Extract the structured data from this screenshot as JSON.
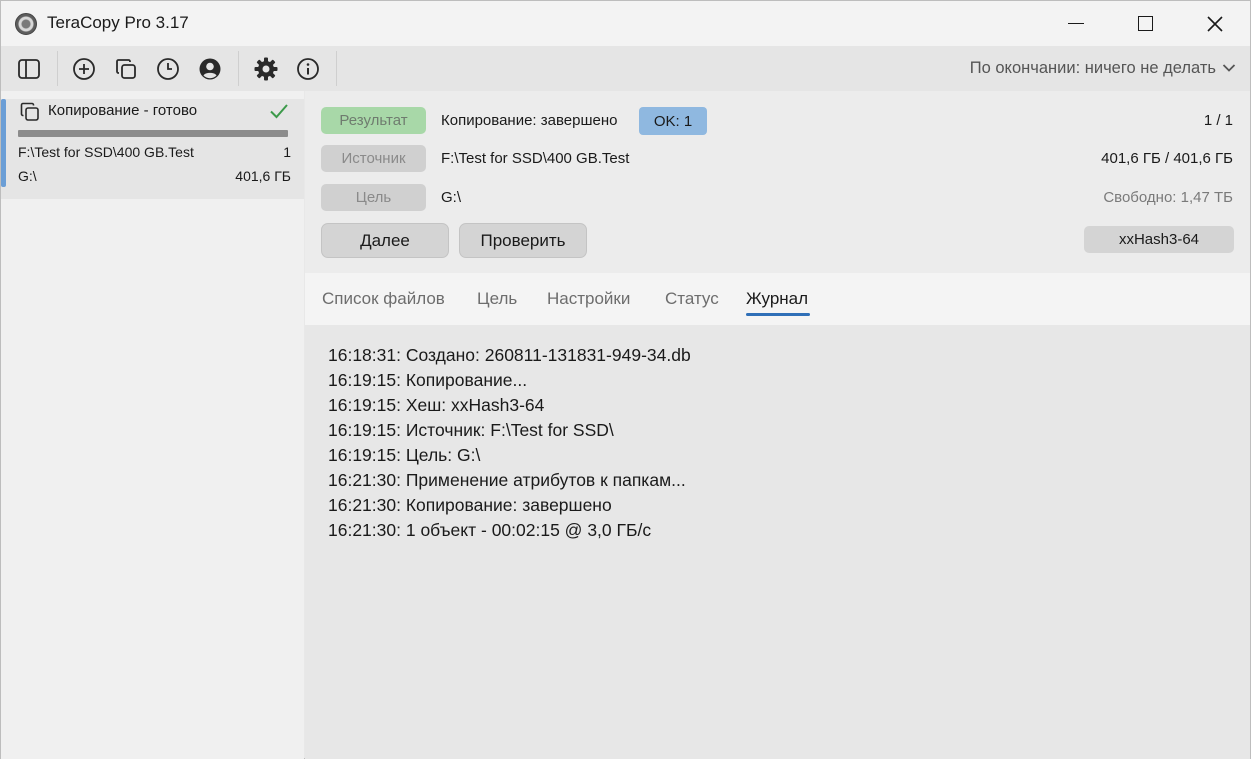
{
  "window": {
    "title": "TeraCopy Pro 3.17",
    "icon": "teracopy-app-icon"
  },
  "toolbar": {
    "buttons": [
      {
        "name": "toggle-panel",
        "icon": "sidebar-icon"
      },
      {
        "name": "add",
        "icon": "plus-circle-icon"
      },
      {
        "name": "copy",
        "icon": "copy-icon"
      },
      {
        "name": "history",
        "icon": "clock-icon"
      },
      {
        "name": "account",
        "icon": "user-circle-icon"
      },
      {
        "name": "settings",
        "icon": "gear-icon"
      },
      {
        "name": "about",
        "icon": "info-icon"
      }
    ],
    "after_completion": "По окончании: ничего не делать"
  },
  "task": {
    "title": "Копирование - готово",
    "progress": 1.0,
    "source": "F:\\Test for SSD\\400 GB.Test",
    "count": "1",
    "target": "G:\\",
    "size": "401,6 ГБ"
  },
  "info": {
    "result_label": "Результат",
    "result_text": "Копирование: завершено",
    "ok_badge": "OK: 1",
    "page": "1 / 1",
    "source_label": "Источник",
    "source_path": "F:\\Test for SSD\\400 GB.Test",
    "source_size": "401,6 ГБ / 401,6 ГБ",
    "target_label": "Цель",
    "target_path": "G:\\",
    "free_space": "Свободно: 1,47 ТБ",
    "next_button": "Далее",
    "verify_button": "Проверить",
    "hash_algorithm": "xxHash3-64"
  },
  "tabs": [
    {
      "label": "Список файлов",
      "active": false
    },
    {
      "label": "Цель",
      "active": false
    },
    {
      "label": "Настройки",
      "active": false
    },
    {
      "label": "Статус",
      "active": false
    },
    {
      "label": "Журнал",
      "active": true
    }
  ],
  "log": [
    "16:18:31: Создано: 260811-131831-949-34.db",
    "16:19:15: Копирование...",
    "16:19:15: Хеш: xxHash3-64",
    "16:19:15: Источник: F:\\Test for SSD\\",
    "16:19:15: Цель: G:\\",
    "16:21:30: Применение атрибутов к папкам...",
    "16:21:30: Копирование: завершено",
    "16:21:30: 1 объект - 00:02:15 @ 3,0 ГБ/с"
  ],
  "colors": {
    "accent": "#2f6fb7",
    "result_green": "#a8d8a8",
    "ok_blue": "#8fb8e0",
    "task_accent": "#6b9ed6",
    "check_green": "#3c9a4a"
  }
}
